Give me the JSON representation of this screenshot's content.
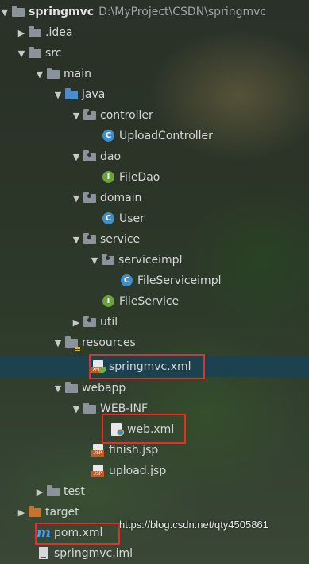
{
  "project": {
    "name": "springmvc",
    "path": "D:\\MyProject\\CSDN\\springmvc"
  },
  "tree": {
    "idea": ".idea",
    "src": "src",
    "main": "main",
    "java": "java",
    "controller": "controller",
    "upload_controller": "UploadController",
    "dao": "dao",
    "file_dao": "FileDao",
    "domain": "domain",
    "user": "User",
    "service": "service",
    "serviceimpl": "serviceimpl",
    "file_service_impl": "FileServiceimpl",
    "file_service": "FileService",
    "util": "util",
    "resources": "resources",
    "springmvc_xml": "springmvc.xml",
    "webapp": "webapp",
    "web_inf": "WEB-INF",
    "web_xml": "web.xml",
    "finish_jsp": "finish.jsp",
    "upload_jsp": "upload.jsp",
    "test": "test",
    "target": "target",
    "pom_xml": "pom.xml",
    "springmvc_iml": "springmvc.iml"
  },
  "icons": {
    "xml_badge": "XML",
    "jsp_badge": "JSP",
    "class_letter": "C",
    "interface_letter": "I",
    "maven_letter": "m"
  },
  "watermark": "https://blog.csdn.net/qty4505861",
  "colors": {
    "selection": "#1c4250",
    "highlight_box": "#e0302a",
    "class_icon": "#3c8ed0",
    "interface_icon": "#69a43a"
  }
}
